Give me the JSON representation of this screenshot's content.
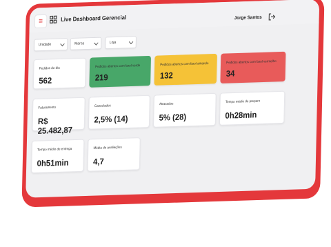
{
  "header": {
    "title": "Live Dashboard Gerencial",
    "user_name": "Jorge Santos"
  },
  "filters": [
    {
      "label": "Unidade"
    },
    {
      "label": "Marca"
    },
    {
      "label": "Loja"
    }
  ],
  "kpis": {
    "pedidos_dia": {
      "label": "Pedidos do dia",
      "value": "562"
    },
    "farol_verde": {
      "label": "Pedidos abertos com farol verde",
      "value": "219"
    },
    "farol_amarelo": {
      "label": "Pedidos abertos com farol amarelo",
      "value": "132"
    },
    "farol_vermelho": {
      "label": "Pedidos abertos com farol vermelho",
      "value": "34"
    },
    "faturamento": {
      "label": "Faturamento",
      "value": "R$ 25.482,87"
    },
    "cancelados": {
      "label": "Cancelados",
      "value": "2,5% (14)"
    },
    "atrasados": {
      "label": "Atrasados",
      "value": "5% (28)"
    },
    "tempo_preparo": {
      "label": "Tempo médio de preparo",
      "value": "0h28min"
    },
    "tempo_entrega": {
      "label": "Tempo médio de entrega",
      "value": "0h51min"
    },
    "media_avaliacoes": {
      "label": "Média de avaliações",
      "value": "4,7"
    }
  },
  "colors": {
    "frame": "#e4383b",
    "green": "#48a769",
    "yellow": "#f5c237",
    "red": "#e85b5a"
  },
  "icons": [
    "menu-icon",
    "dashboard-grid-icon",
    "logout-icon",
    "chevron-down-icon"
  ]
}
